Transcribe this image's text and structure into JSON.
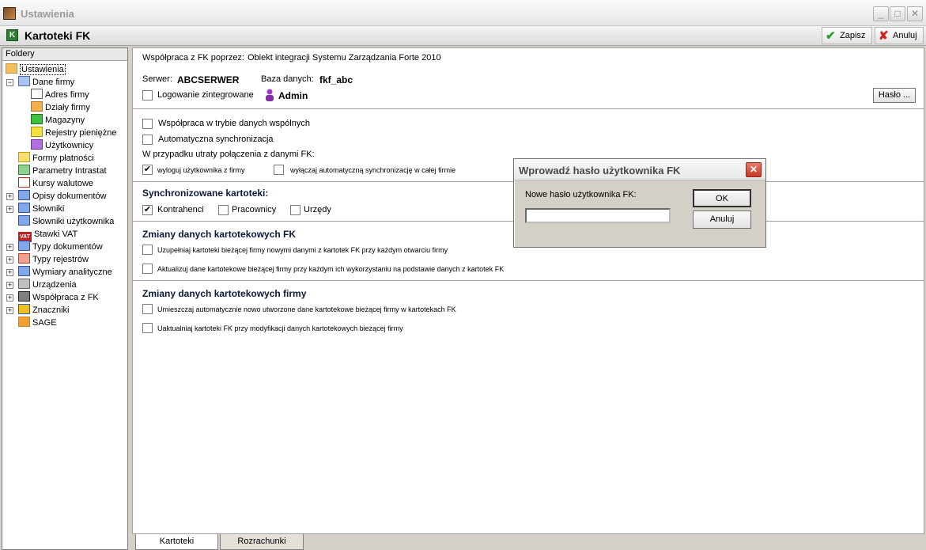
{
  "window": {
    "title": "Ustawienia",
    "min_glyph": "_",
    "max_glyph": "□",
    "close_glyph": "✕"
  },
  "header": {
    "title": "Kartoteki FK",
    "icon_glyph": "K",
    "save_label": "Zapisz",
    "save_icon": "✔",
    "cancel_label": "Anuluj",
    "cancel_icon": "✘"
  },
  "folders": {
    "header": "Foldery",
    "items": [
      {
        "label": "Ustawienia",
        "icon": "settings-icon"
      },
      {
        "label": "Dane firmy",
        "icon": "company-icon"
      },
      {
        "label": "Adres firmy",
        "icon": "envelope-icon"
      },
      {
        "label": "Działy firmy",
        "icon": "departments-icon"
      },
      {
        "label": "Magazyny",
        "icon": "warehouse-icon"
      },
      {
        "label": "Rejestry pieniężne",
        "icon": "coins-icon"
      },
      {
        "label": "Użytkownicy",
        "icon": "users-icon"
      },
      {
        "label": "Formy płatności",
        "icon": "payment-icon"
      },
      {
        "label": "Parametry Intrastat",
        "icon": "intrastat-icon"
      },
      {
        "label": "Kursy walutowe",
        "icon": "chart-icon"
      },
      {
        "label": "Opisy dokumentów",
        "icon": "document-icon"
      },
      {
        "label": "Słowniki",
        "icon": "dictionary-icon"
      },
      {
        "label": "Słowniki użytkownika",
        "icon": "dictionary-icon"
      },
      {
        "label": "Stawki VAT",
        "icon": "vat-icon",
        "badge": "VAT"
      },
      {
        "label": "Typy dokumentów",
        "icon": "document-icon"
      },
      {
        "label": "Typy rejestrów",
        "icon": "grid-icon"
      },
      {
        "label": "Wymiary analityczne",
        "icon": "dimensions-icon"
      },
      {
        "label": "Urządzenia",
        "icon": "device-icon"
      },
      {
        "label": "Współpraca z FK",
        "icon": "handshake-icon"
      },
      {
        "label": "Znaczniki",
        "icon": "tags-icon"
      },
      {
        "label": "SAGE",
        "icon": "sage-icon"
      }
    ]
  },
  "main": {
    "cooperation_label": "Współpraca z FK poprzez:",
    "cooperation_value": "Obiekt integracji Systemu Zarządzania Forte 2010",
    "server_label": "Serwer:",
    "server_value": "ABCSERWER",
    "db_label": "Baza danych:",
    "db_value": "fkf_abc",
    "integrated_login": "Logowanie zintegrowane",
    "user_value": "Admin",
    "password_button": "Hasło ...",
    "shared_mode": "Współpraca w trybie danych wspólnych",
    "auto_sync": "Automatyczna synchronizacja",
    "lost_connection": "W przypadku utraty połączenia z danymi FK:",
    "logout_user": "wyloguj użytkownika z firmy",
    "disable_sync": "wyłączaj automatyczną synchronizację w całej firmie",
    "check_glyph": "✔",
    "sync_heading": "Synchronizowane kartoteki:",
    "sync_contractors": "Kontrahenci",
    "sync_employees": "Pracownicy",
    "sync_offices": "Urzędy",
    "fk_changes_heading": "Zmiany danych kartotekowych FK",
    "fk_change_1": "Uzupełniaj kartoteki bieżącej firmy nowymi danymi z kartotek FK przy każdym otwarciu firmy",
    "fk_change_2": "Aktualizuj dane kartotekowe bieżącej firmy przy każdym ich wykorzystaniu na podstawie danych z kartotek FK",
    "firm_changes_heading": "Zmiany danych kartotekowych firmy",
    "firm_change_1": "Umieszczaj automatycznie nowo utworzone dane kartotekowe bieżącej firmy w kartotekach FK",
    "firm_change_2": "Uaktualniaj kartoteki FK przy modyfikacji danych kartotekowych bieżącej firmy"
  },
  "tabs": [
    {
      "label": "Kartoteki",
      "active": true
    },
    {
      "label": "Rozrachunki",
      "active": false
    }
  ],
  "dialog": {
    "title": "Wprowadź hasło użytkownika FK",
    "close_glyph": "✕",
    "field_label": "Nowe hasło użytkownika FK:",
    "field_value": "",
    "ok_label": "OK",
    "cancel_label": "Anuluj"
  }
}
